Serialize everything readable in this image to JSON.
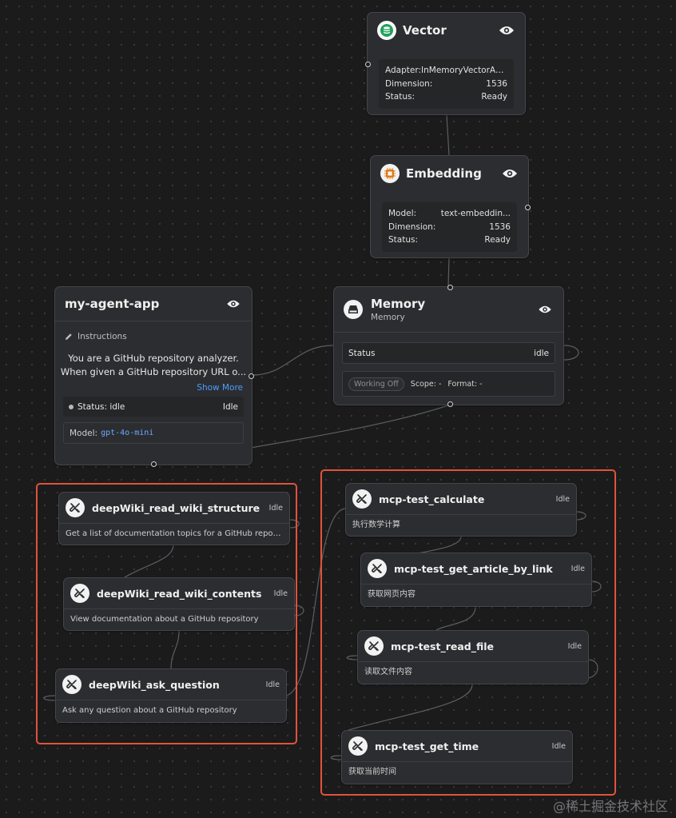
{
  "colors": {
    "background": "#1b1b1c",
    "node": "#2c2d30",
    "selection": "#e1533a",
    "link": "#4a9eff"
  },
  "vector": {
    "title": "Vector",
    "icon": "database-icon",
    "rows": [
      {
        "label": "Adapter:",
        "value": "InMemoryVectorAdapter"
      },
      {
        "label": "Dimension:",
        "value": "1536"
      },
      {
        "label": "Status:",
        "value": "Ready"
      }
    ]
  },
  "embedding": {
    "title": "Embedding",
    "icon": "chip-icon",
    "rows": [
      {
        "label": "Model:",
        "value": "text-embeddin..."
      },
      {
        "label": "Dimension:",
        "value": "1536"
      },
      {
        "label": "Status:",
        "value": "Ready"
      }
    ]
  },
  "agent": {
    "title": "my-agent-app",
    "instructions_label": "Instructions",
    "instructions_line1": "You are a GitHub repository analyzer.",
    "instructions_line2": "When given a GitHub repository URL o...",
    "show_more": "Show More",
    "status_label": "Status: idle",
    "status_value": "Idle",
    "model_label": "Model:",
    "model_value": "gpt-4o-mini"
  },
  "memory": {
    "title": "Memory",
    "subtitle": "Memory",
    "status_label": "Status",
    "status_value": "idle",
    "working_badge": "Working Off",
    "scope": "Scope: -",
    "format": "Format: -"
  },
  "deepwiki_tools": [
    {
      "name": "deepWiki_read_wiki_structure",
      "status": "Idle",
      "desc": "Get a list of documentation topics for a GitHub reposit..."
    },
    {
      "name": "deepWiki_read_wiki_contents",
      "status": "Idle",
      "desc": "View documentation about a GitHub repository"
    },
    {
      "name": "deepWiki_ask_question",
      "status": "Idle",
      "desc": "Ask any question about a GitHub repository"
    }
  ],
  "mcp_tools": [
    {
      "name": "mcp-test_calculate",
      "status": "Idle",
      "desc": "执行数学计算"
    },
    {
      "name": "mcp-test_get_article_by_link",
      "status": "Idle",
      "desc": "获取网页内容"
    },
    {
      "name": "mcp-test_read_file",
      "status": "Idle",
      "desc": "读取文件内容"
    },
    {
      "name": "mcp-test_get_time",
      "status": "Idle",
      "desc": "获取当前时间"
    }
  ],
  "watermark": "@稀土掘金技术社区"
}
